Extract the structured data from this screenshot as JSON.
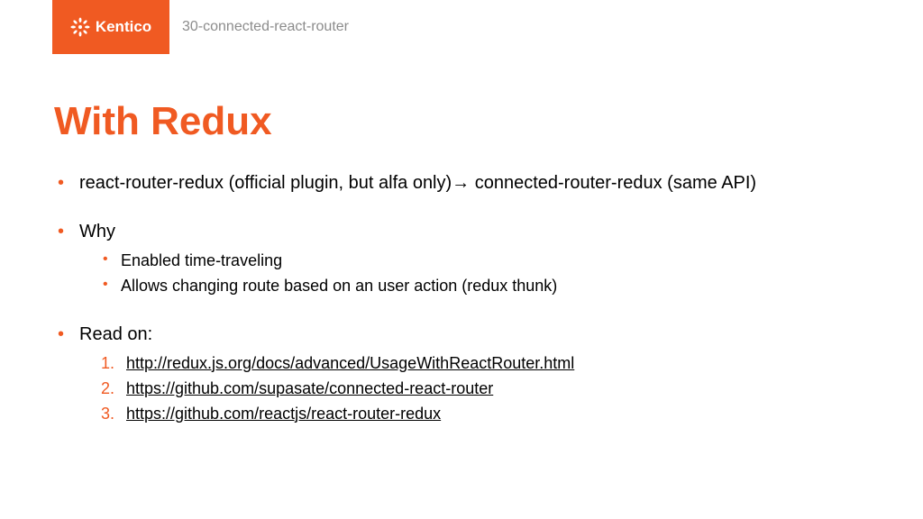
{
  "header": {
    "brand": "Kentico",
    "breadcrumb": "30-connected-react-router"
  },
  "slide": {
    "title": "With Redux",
    "bullets": [
      {
        "text": "react-router-redux (official plugin, but alfa only)→ connected-router-redux (same API)"
      },
      {
        "text": "Why",
        "sub": [
          "Enabled time-traveling",
          "Allows changing route based on an user action (redux thunk)"
        ]
      },
      {
        "text": "Read on:",
        "links": [
          "http://redux.js.org/docs/advanced/UsageWithReactRouter.html",
          "https://github.com/supasate/connected-react-router",
          "https://github.com/reactjs/react-router-redux"
        ]
      }
    ]
  },
  "colors": {
    "accent": "#f05a22"
  }
}
